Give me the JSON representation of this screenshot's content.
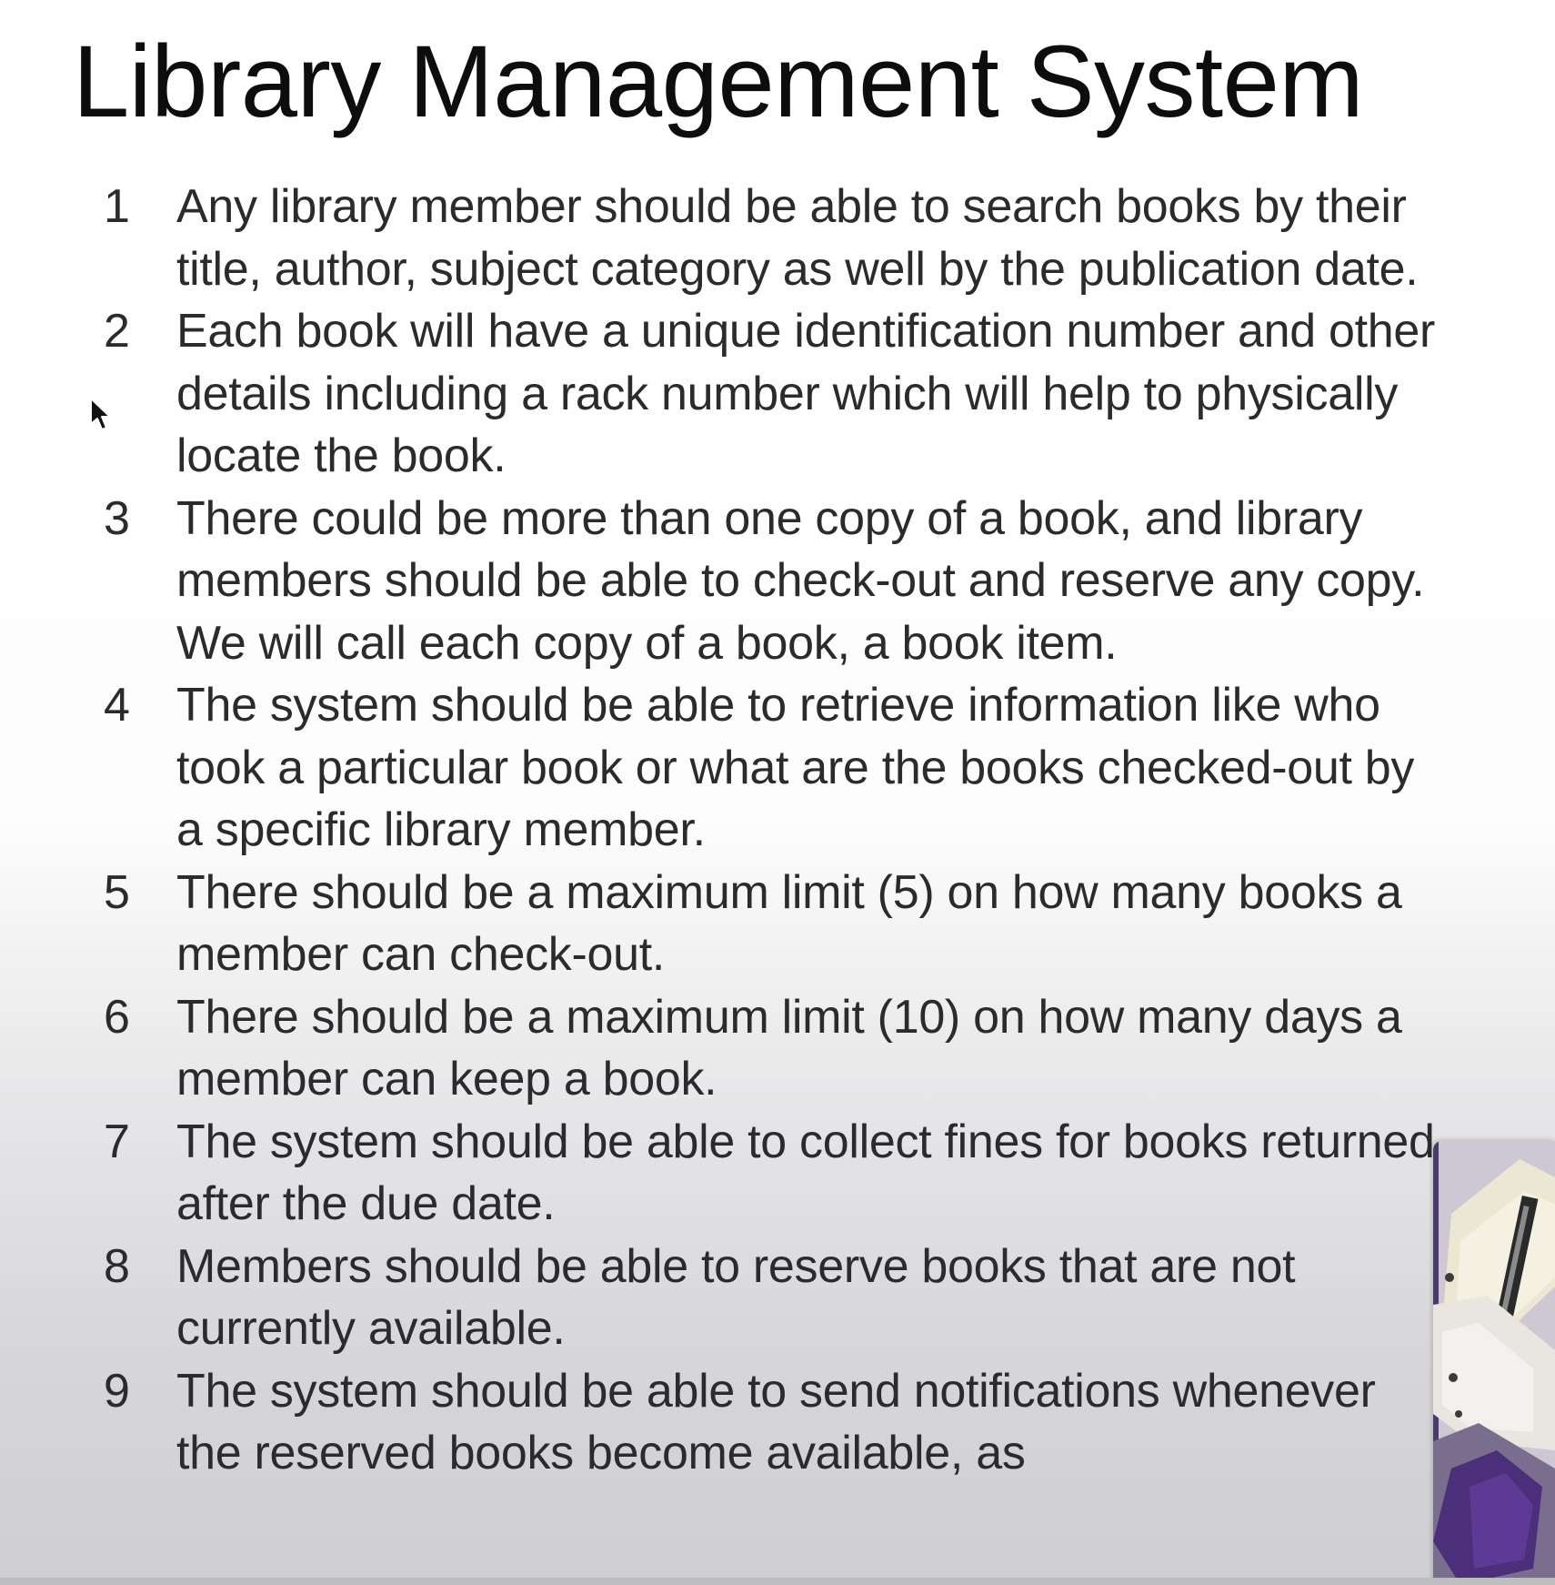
{
  "slide": {
    "title": "Library Management System",
    "requirements": [
      {
        "number": "1",
        "text": "Any library member should be able to search books by their title, author, subject category as well by the publication date."
      },
      {
        "number": "2",
        "text": "Each book will have a unique identification number and other details including a rack number which will help to physically locate the book."
      },
      {
        "number": "3",
        "text": "There could be more than one copy of a book, and library members should be able to check-out and reserve any copy. We will call each copy of a book, a book item."
      },
      {
        "number": "4",
        "text": "The system should be able to retrieve information like who took a particular book or what are the books checked-out by a specific library member."
      },
      {
        "number": "5",
        "text": "There should be a maximum limit (5) on how many books a member can check-out."
      },
      {
        "number": "6",
        "text": "There should be a maximum limit (10) on how many days a member can keep a book."
      },
      {
        "number": "7",
        "text": "The system should be able to collect fines for books returned after the due date."
      },
      {
        "number": "8",
        "text": "Members should be able to reserve books that are not currently available."
      },
      {
        "number": "9",
        "text": "The system should be able to send notifications whenever the reserved books become available, as"
      }
    ]
  },
  "icons": {
    "cursor": "mouse-pointer-icon",
    "webcam": "webcam-overlay"
  }
}
